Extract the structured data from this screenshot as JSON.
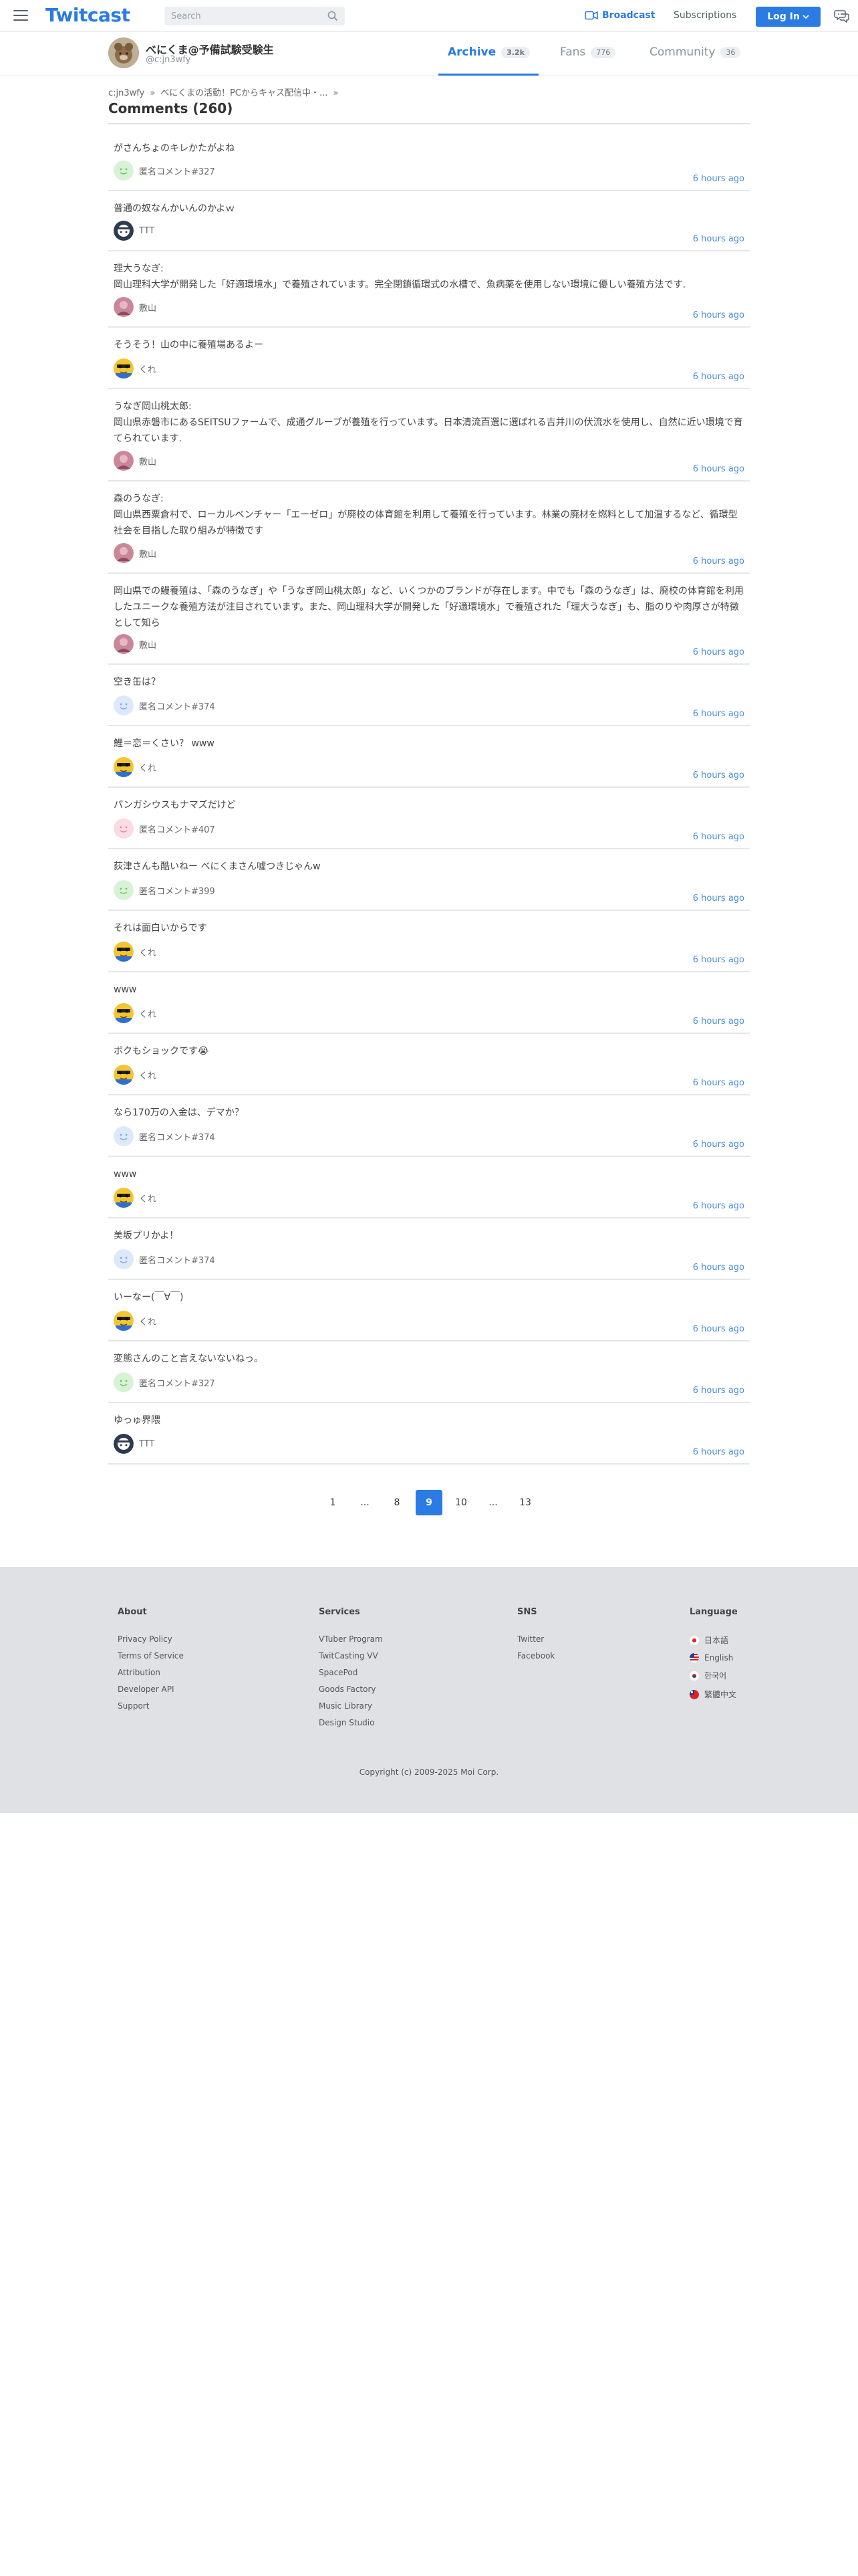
{
  "nav": {
    "logo": "Twitcast",
    "search_placeholder": "Search",
    "broadcast": "Broadcast",
    "subscriptions": "Subscriptions",
    "login": "Log In"
  },
  "profile": {
    "name": "べにくま@予備試験受験生",
    "handle": "@c:jn3wfy",
    "tabs": [
      {
        "label": "Archive",
        "count": "3.2k"
      },
      {
        "label": "Fans",
        "count": "776"
      },
      {
        "label": "Community",
        "count": "36"
      }
    ]
  },
  "breadcrumb": [
    "c:jn3wfy",
    "»",
    "べにくまの活動！PCからキャス配信中・...",
    "»"
  ],
  "page_title": "Comments (260)",
  "comments": [
    {
      "text": "がさんちょのキレかたがよね",
      "user": "匿名コメント#327",
      "avatar": "anon-green",
      "time": "6 hours ago"
    },
    {
      "text": "普通の奴なんかいんのかよｗ",
      "user": "TTT",
      "avatar": "ttt",
      "time": "6 hours ago"
    },
    {
      "text": "理大うなぎ:\n岡山理科大学が開発した「好適環境水」で養殖されています。完全閉鎖循環式の水槽で、魚病薬を使用しない環境に優しい養殖方法です.",
      "user": "敷山",
      "avatar": "pink",
      "time": "6 hours ago"
    },
    {
      "text": "そうそう！山の中に養殖場あるよー",
      "user": "くれ",
      "avatar": "kure",
      "time": "6 hours ago"
    },
    {
      "text": "うなぎ岡山桃太郎:\n岡山県赤磐市にあるSEITSUファームで、成通グループが養殖を行っています。日本清流百選に選ばれる吉井川の伏流水を使用し、自然に近い環境で育てられています.",
      "user": "敷山",
      "avatar": "pink",
      "time": "6 hours ago"
    },
    {
      "text": "森のうなぎ:\n岡山県西粟倉村で、ローカルベンチャー「エーゼロ」が廃校の体育館を利用して養殖を行っています。林業の廃材を燃料として加温するなど、循環型社会を目指した取り組みが特徴です",
      "user": "敷山",
      "avatar": "pink",
      "time": "6 hours ago"
    },
    {
      "text": "岡山県での鰻養殖は、「森のうなぎ」や「うなぎ岡山桃太郎」など、いくつかのブランドが存在します。中でも「森のうなぎ」は、廃校の体育館を利用したユニークな養殖方法が注目されています。また、岡山理科大学が開発した「好適環境水」で養殖された「理大うなぎ」も、脂のりや肉厚さが特徴として知ら",
      "user": "敷山",
      "avatar": "pink",
      "time": "6 hours ago"
    },
    {
      "text": "空き缶は？",
      "user": "匿名コメント#374",
      "avatar": "anon-blue",
      "time": "6 hours ago"
    },
    {
      "text": "鯉＝恋＝くさい？ www",
      "user": "くれ",
      "avatar": "kure",
      "time": "6 hours ago"
    },
    {
      "text": "パンガシウスもナマズだけど",
      "user": "匿名コメント#407",
      "avatar": "anon-pink",
      "time": "6 hours ago"
    },
    {
      "text": "荻津さんも酷いねー べにくまさん嘘つきじゃんw",
      "user": "匿名コメント#399",
      "avatar": "anon-green",
      "time": "6 hours ago"
    },
    {
      "text": "それは面白いからです",
      "user": "くれ",
      "avatar": "kure",
      "time": "6 hours ago"
    },
    {
      "text": "www",
      "user": "くれ",
      "avatar": "kure",
      "time": "6 hours ago"
    },
    {
      "text": "ボクもショックです😭",
      "user": "くれ",
      "avatar": "kure",
      "time": "6 hours ago"
    },
    {
      "text": "なら170万の入金は、デマか？",
      "user": "匿名コメント#374",
      "avatar": "anon-blue",
      "time": "6 hours ago"
    },
    {
      "text": "www",
      "user": "くれ",
      "avatar": "kure",
      "time": "6 hours ago"
    },
    {
      "text": "美坂プリかよ！",
      "user": "匿名コメント#374",
      "avatar": "anon-blue",
      "time": "6 hours ago"
    },
    {
      "text": "いーなー(￣∀￣)",
      "user": "くれ",
      "avatar": "kure",
      "time": "6 hours ago"
    },
    {
      "text": "変態さんのこと言えないないねっ。",
      "user": "匿名コメント#327",
      "avatar": "anon-green",
      "time": "6 hours ago"
    },
    {
      "text": "ゆっゅ界隈",
      "user": "TTT",
      "avatar": "ttt",
      "time": "6 hours ago"
    }
  ],
  "pagination": {
    "pages": [
      "1",
      "...",
      "8",
      "9",
      "10",
      "...",
      "13"
    ],
    "current": "9"
  },
  "footer": {
    "about": {
      "title": "About",
      "links": [
        "Privacy Policy",
        "Terms of Service",
        "Attribution",
        "Developer API",
        "Support"
      ]
    },
    "services": {
      "title": "Services",
      "links": [
        "VTuber Program",
        "TwitCasting VV",
        "SpacePod",
        "Goods Factory",
        "Music Library",
        "Design Studio"
      ]
    },
    "sns": {
      "title": "SNS",
      "links": [
        "Twitter",
        "Facebook"
      ]
    },
    "language": {
      "title": "Language",
      "links": [
        "日本語",
        "English",
        "한국어",
        "繁體中文"
      ]
    },
    "copyright": "Copyright (c) 2009-2025 Moi Corp."
  },
  "colors": {
    "accent": "#2a7be4",
    "time": "#4a8fd9",
    "footer_bg": "#dfe1e5"
  }
}
